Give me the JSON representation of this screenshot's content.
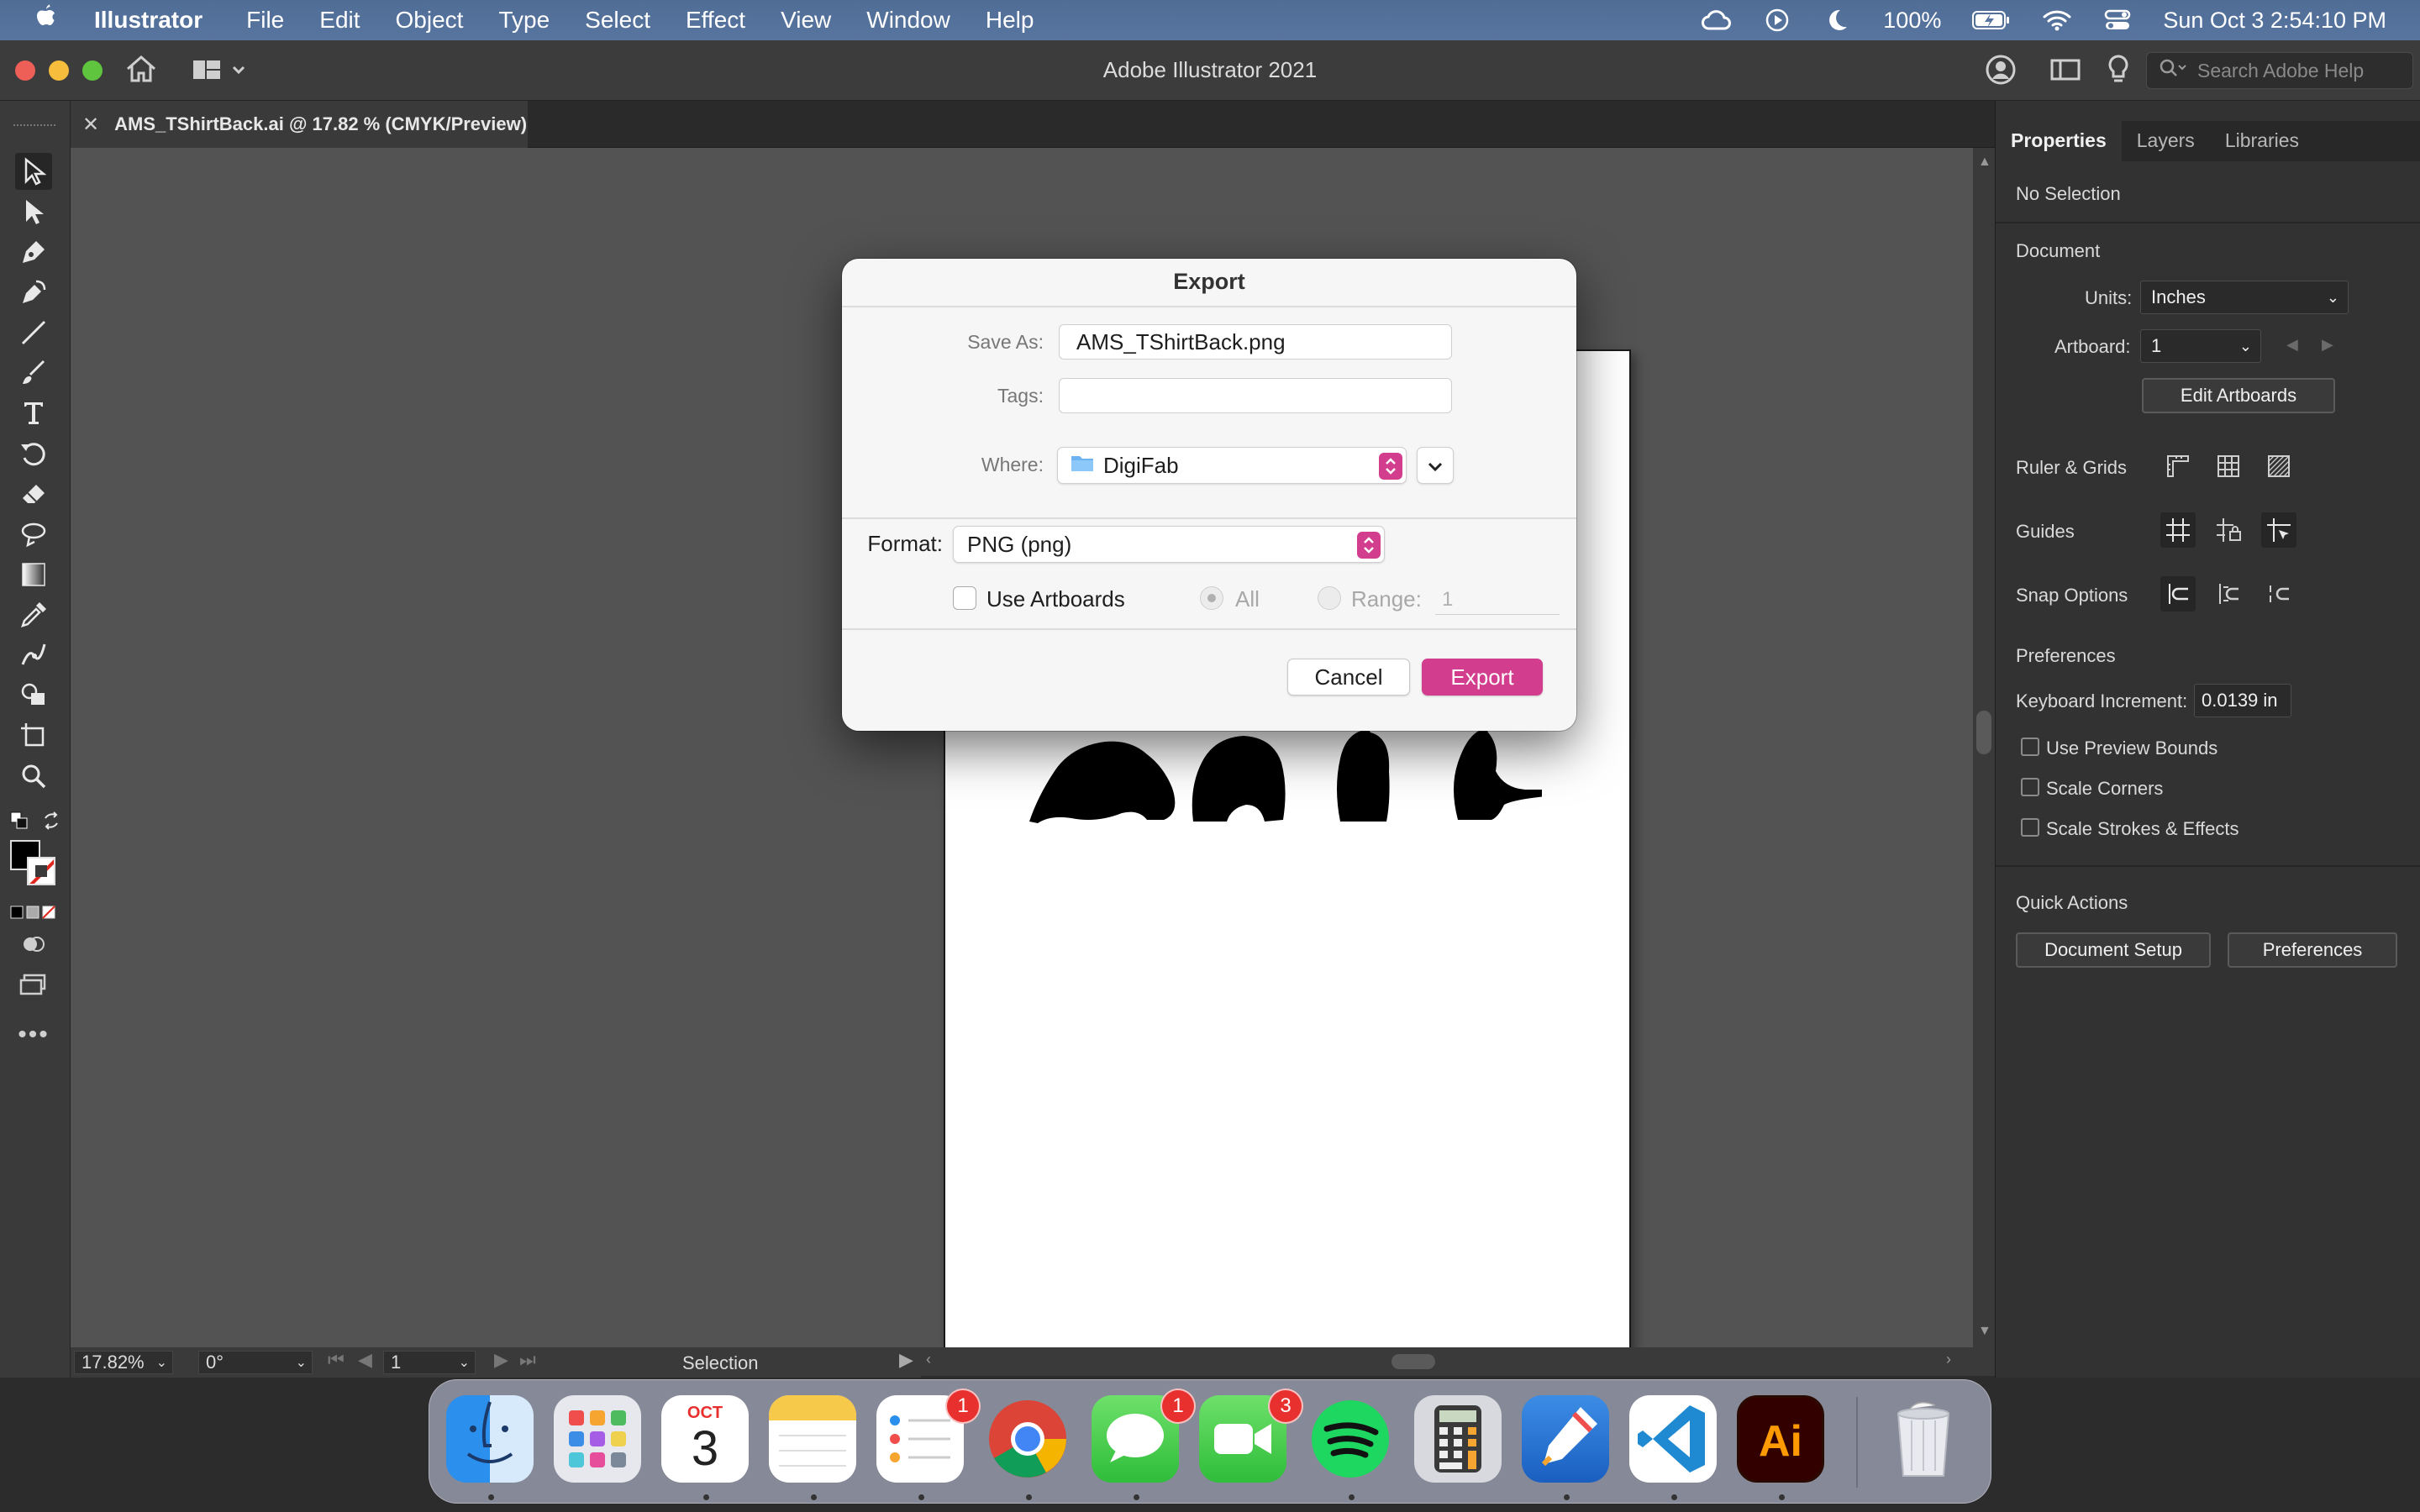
{
  "menubar": {
    "app_name": "Illustrator",
    "menus": [
      "File",
      "Edit",
      "Object",
      "Type",
      "Select",
      "Effect",
      "View",
      "Window",
      "Help"
    ],
    "battery": "100%",
    "clock": "Sun Oct 3  2:54:10 PM"
  },
  "titlebar": {
    "title": "Adobe Illustrator 2021",
    "search_placeholder": "Search Adobe Help"
  },
  "document_tab": {
    "label": "AMS_TShirtBack.ai @ 17.82 % (CMYK/Preview)"
  },
  "statusbar": {
    "zoom": "17.82%",
    "rotation": "0°",
    "artboard": "1",
    "tool": "Selection"
  },
  "panel": {
    "tabs": [
      "Properties",
      "Layers",
      "Libraries"
    ],
    "selection": "No Selection",
    "document_heading": "Document",
    "units_label": "Units:",
    "units_value": "Inches",
    "artboard_label": "Artboard:",
    "artboard_value": "1",
    "edit_artboards": "Edit Artboards",
    "ruler_grids": "Ruler & Grids",
    "guides": "Guides",
    "snap_options": "Snap Options",
    "preferences_heading": "Preferences",
    "keyboard_increment_label": "Keyboard Increment:",
    "keyboard_increment_value": "0.0139 in",
    "checkboxes": [
      "Use Preview Bounds",
      "Scale Corners",
      "Scale Strokes & Effects"
    ],
    "quick_actions_heading": "Quick Actions",
    "document_setup": "Document Setup",
    "preferences_button": "Preferences"
  },
  "dialog": {
    "title": "Export",
    "save_as_label": "Save As:",
    "save_as_value": "AMS_TShirtBack.png",
    "tags_label": "Tags:",
    "tags_value": "",
    "where_label": "Where:",
    "where_value": "DigiFab",
    "format_label": "Format:",
    "format_value": "PNG (png)",
    "use_artboards": "Use Artboards",
    "all_label": "All",
    "range_label": "Range:",
    "range_value": "1",
    "cancel": "Cancel",
    "export": "Export"
  },
  "dock": {
    "calendar_month": "OCT",
    "calendar_day": "3",
    "reminders_badge": "1",
    "messages_badge": "1",
    "facetime_badge": "3",
    "illustrator_label": "Ai"
  },
  "colors": {
    "accent_pink": "#d23d8d",
    "menubar_blue": "#5373a0",
    "panel_bg": "#323232",
    "canvas_bg": "#535353"
  }
}
